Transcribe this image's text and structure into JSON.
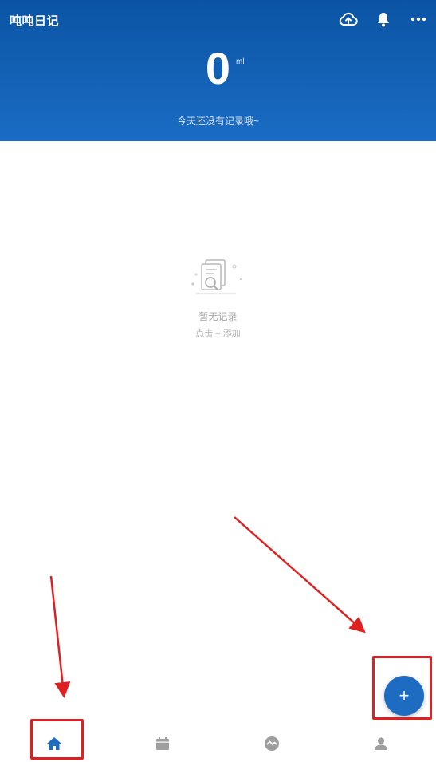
{
  "header": {
    "title": "吨吨日记",
    "icons": [
      "cloud-upload-icon",
      "bell-icon",
      "more-icon"
    ],
    "amount_value": "0",
    "amount_unit": "ml",
    "subtitle": "今天还没有记录哦~"
  },
  "empty_state": {
    "icon": "empty-document-search-icon",
    "title": "暂无记录",
    "hint": "点击 + 添加"
  },
  "fab": {
    "label": "+"
  },
  "tabbar": {
    "tabs": [
      {
        "icon": "home-icon",
        "active": true
      },
      {
        "icon": "calendar-icon",
        "active": false
      },
      {
        "icon": "stats-icon",
        "active": false
      },
      {
        "icon": "profile-icon",
        "active": false
      }
    ]
  },
  "colors": {
    "header_top": "#0b54a4",
    "header_bottom": "#1a6cc4",
    "accent": "#1e6cc1",
    "tab_inactive": "#9e9e9e",
    "annotation_red": "#e02020"
  }
}
